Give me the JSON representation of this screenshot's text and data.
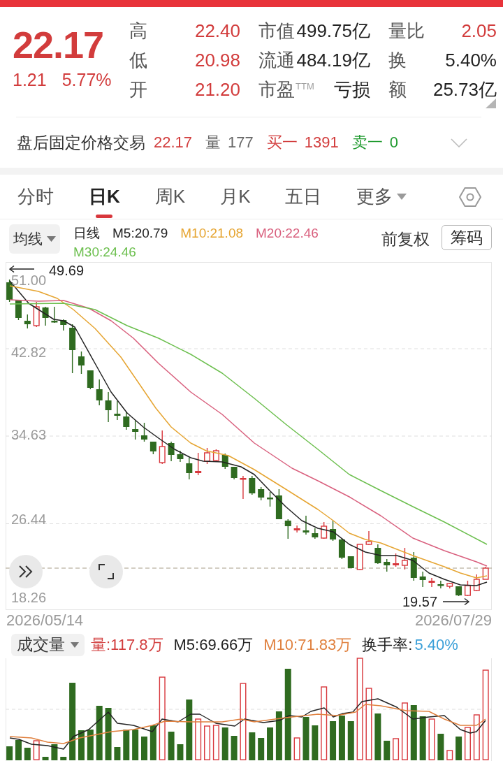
{
  "quote": {
    "price": "22.17",
    "change": "1.21",
    "change_percent": "5.77%"
  },
  "stats": [
    {
      "label": "高",
      "value": "22.40",
      "color": "#d23c3c"
    },
    {
      "label": "市值",
      "value": "499.75亿",
      "color": "#222222"
    },
    {
      "label": "量比",
      "value": "2.05",
      "color": "#d23c3c"
    },
    {
      "label": "低",
      "value": "20.98",
      "color": "#d23c3c"
    },
    {
      "label": "流通",
      "value": "484.19亿",
      "color": "#222222"
    },
    {
      "label": "换",
      "value": "5.40%",
      "color": "#222222"
    },
    {
      "label": "开",
      "value": "21.20",
      "color": "#d23c3c"
    },
    {
      "label": "市盈$^{TTM}$",
      "value": "亏损",
      "color": "#222222"
    },
    {
      "label": "额",
      "value": "25.73亿",
      "color": "#222222"
    }
  ],
  "after_hours": {
    "title": "盘后固定价格交易",
    "price": "22.17",
    "items": [
      {
        "label": "量",
        "value": "177",
        "color": "#666666"
      },
      {
        "label": "买一",
        "value": "1391",
        "color": "#d23c3c"
      },
      {
        "label": "卖一",
        "value": "0",
        "color": "#1f9a2e"
      }
    ]
  },
  "tabs": [
    {
      "label": "分时",
      "selected": false,
      "kind": "tab"
    },
    {
      "label": "日K",
      "selected": true,
      "kind": "tab"
    },
    {
      "label": "周K",
      "selected": false,
      "kind": "tab"
    },
    {
      "label": "月K",
      "selected": false,
      "kind": "tab"
    },
    {
      "label": "五日",
      "selected": false,
      "kind": "tab"
    },
    {
      "label": "更多",
      "selected": false,
      "kind": "menu"
    }
  ],
  "indicators": {
    "selector": "均线",
    "period": "日线",
    "averages": [
      {
        "label": "M5:20.79",
        "color": "#222222"
      },
      {
        "label": "M10:21.08",
        "color": "#e6a532"
      },
      {
        "label": "M20:22.46",
        "color": "#d9607e"
      },
      {
        "label": "M30:24.46",
        "color": "#6cbf4e"
      }
    ],
    "adjustment": "前复权",
    "chips_button": "筹码"
  },
  "price_chart": {
    "y_labels": [
      "51.00",
      "42.82",
      "34.63",
      "26.44",
      "18.26"
    ],
    "high": "49.69",
    "low": "19.57",
    "start_date": "2026/05/14",
    "end_date": "2026/07/29"
  },
  "volume": {
    "selector": "成交量",
    "current": "量:117.8万",
    "averages": [
      {
        "label": "M5:69.66万",
        "color": "#222222"
      },
      {
        "label": "M10:71.83万",
        "color": "#e0803e"
      }
    ],
    "turnover_label": "换手率:",
    "turnover": "5.40%"
  }
}
